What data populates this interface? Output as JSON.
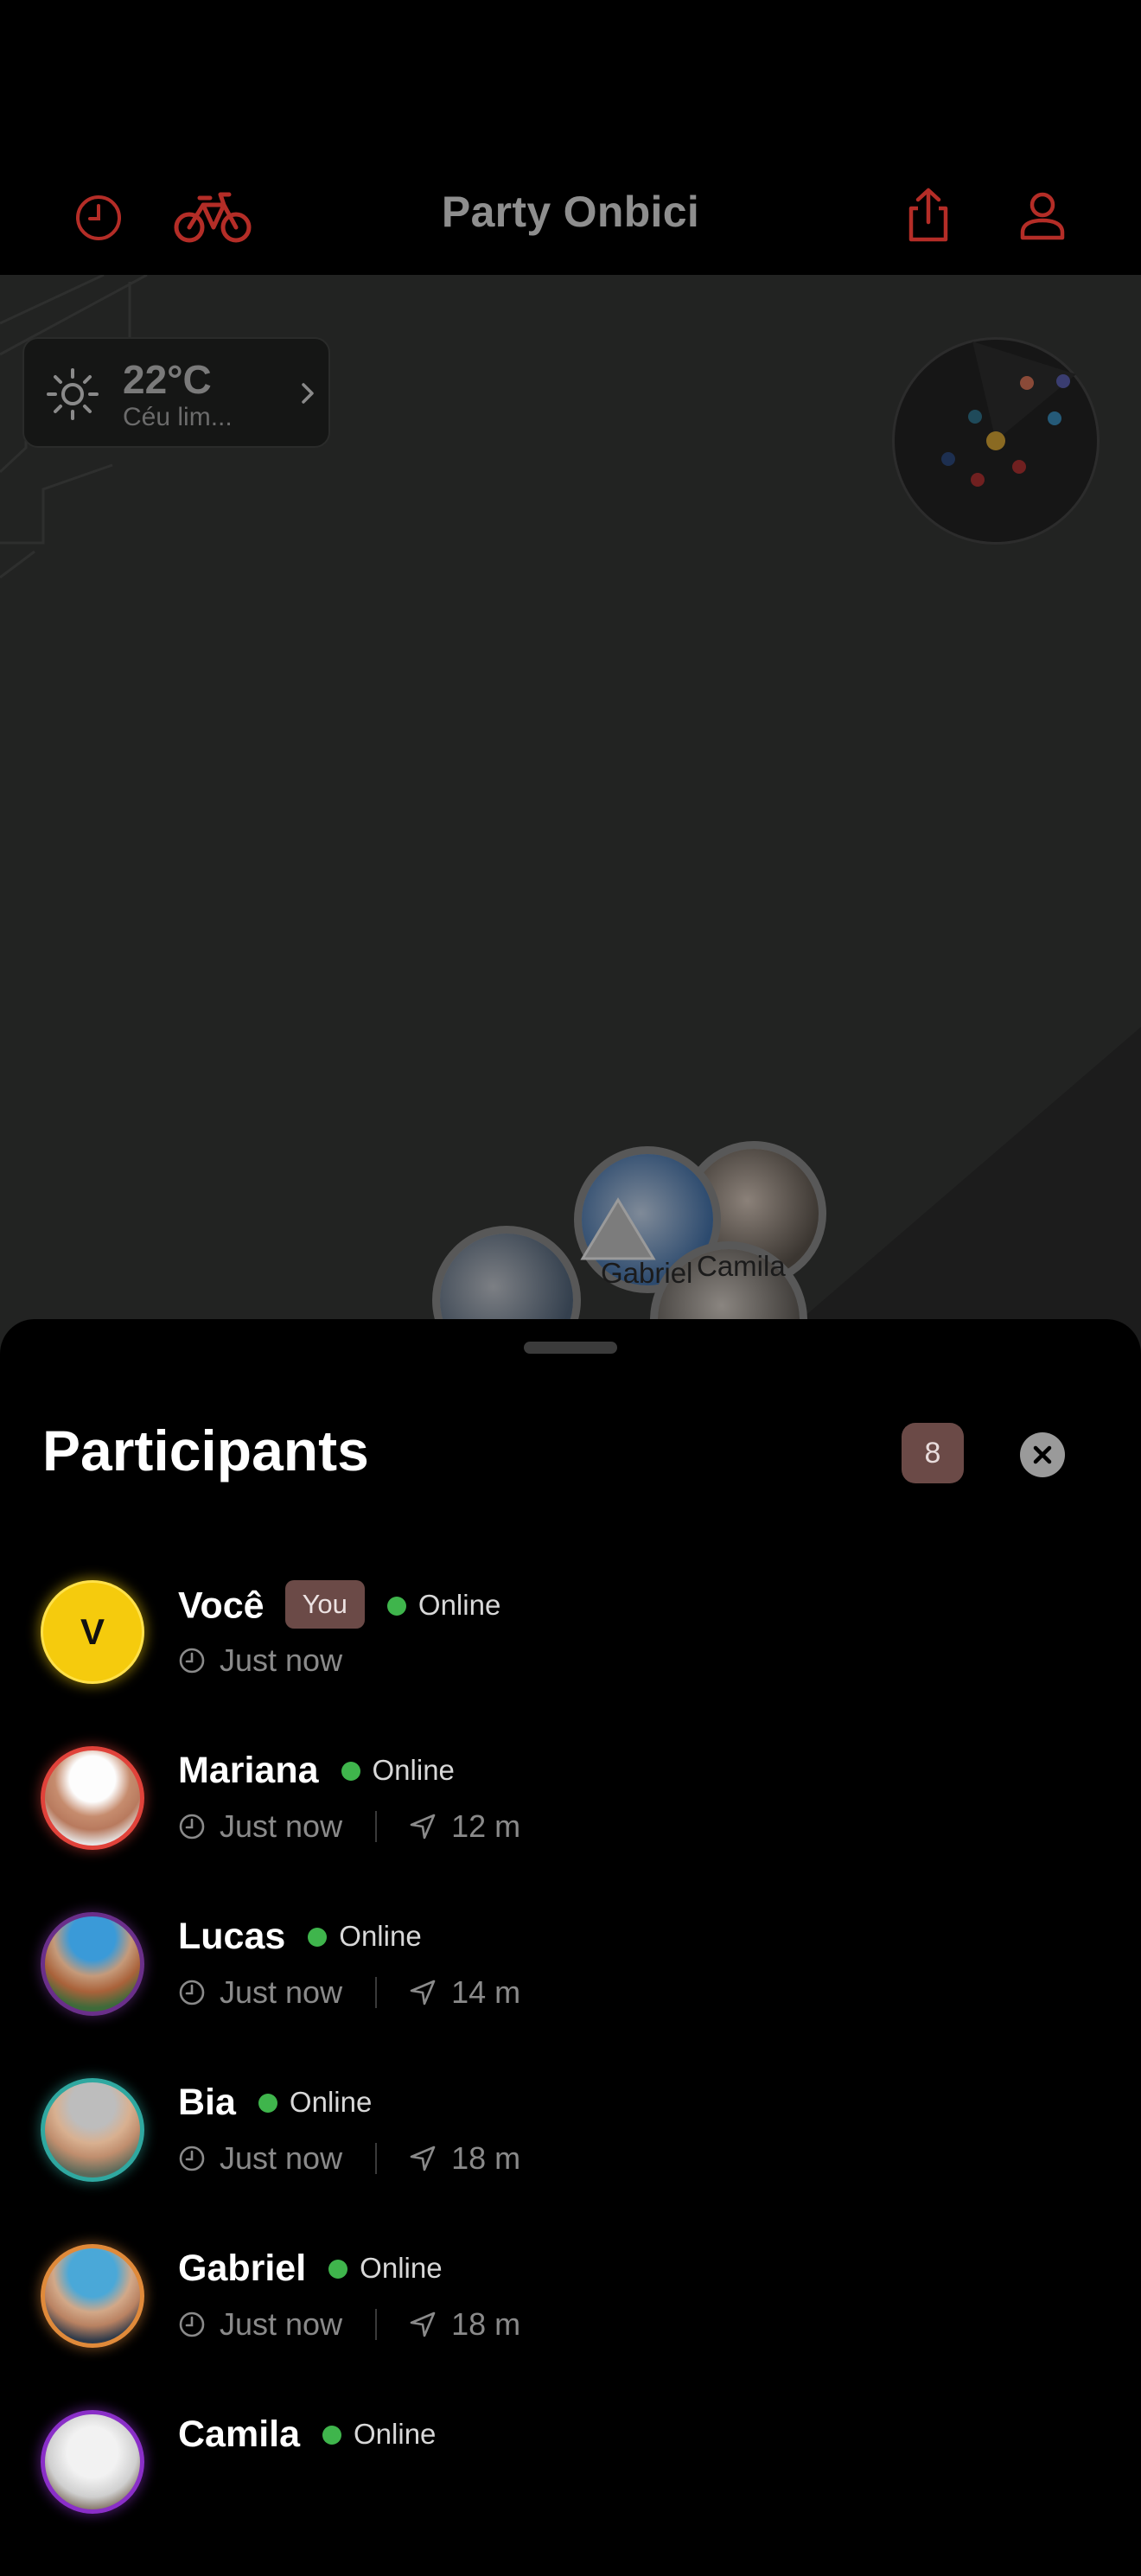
{
  "header": {
    "title": "Party Onbici",
    "icons": [
      "clock-icon",
      "bicycle-icon",
      "share-icon",
      "profile-icon"
    ]
  },
  "map": {
    "weather": {
      "temperature": "22°C",
      "condition": "Céu lim...",
      "icon": "sun-icon"
    },
    "pins": [
      {
        "label": "Gabriel"
      },
      {
        "label": "Camila"
      }
    ]
  },
  "participants": {
    "title": "Participants",
    "count": "8",
    "items": [
      {
        "name": "Você",
        "is_you": true,
        "you_label": "You",
        "status": "Online",
        "time": "Just now",
        "distance": "",
        "avatar_letter": "V"
      },
      {
        "name": "Mariana",
        "status": "Online",
        "time": "Just now",
        "distance": "12 m"
      },
      {
        "name": "Lucas",
        "status": "Online",
        "time": "Just now",
        "distance": "14 m"
      },
      {
        "name": "Bia",
        "status": "Online",
        "time": "Just now",
        "distance": "18 m"
      },
      {
        "name": "Gabriel",
        "status": "Online",
        "time": "Just now",
        "distance": "18 m"
      },
      {
        "name": "Camila",
        "status": "Online",
        "time": "",
        "distance": ""
      }
    ]
  },
  "colors": {
    "accent": "#c0312b",
    "online": "#3fb54c",
    "badge": "#6b4a47",
    "you_avatar": "#f5cb0d"
  }
}
